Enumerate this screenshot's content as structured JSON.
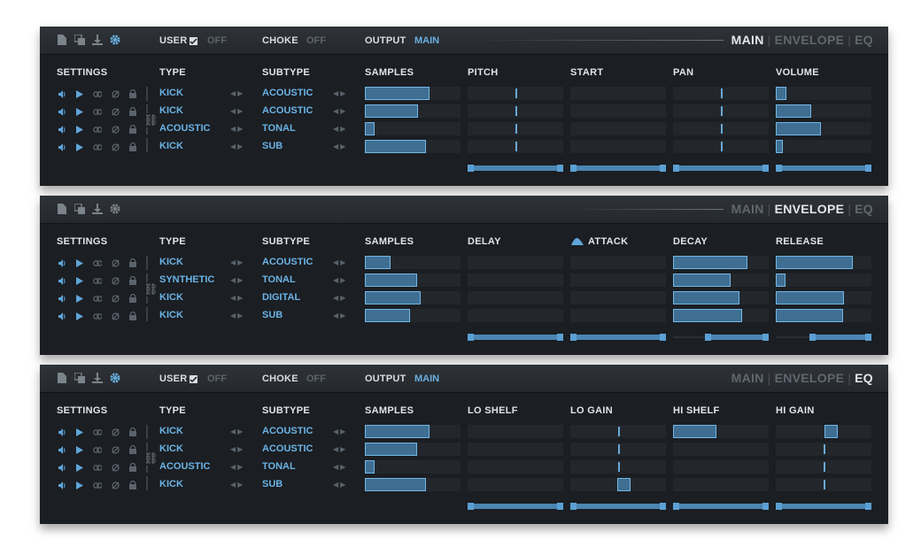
{
  "header": {
    "user_label": "USER",
    "user_value": "OFF",
    "choke_label": "CHOKE",
    "choke_value": "OFF",
    "output_label": "OUTPUT",
    "output_value": "MAIN",
    "tab_main": "MAIN",
    "tab_envelope": "ENVELOPE",
    "tab_eq": "EQ",
    "sep": "|"
  },
  "columns": {
    "settings": "SETTINGS",
    "type": "TYPE",
    "subtype": "SUBTYPE",
    "samples": "SAMPLES"
  },
  "colors": {
    "accent": "#68afe0",
    "panel": "#1b1e22",
    "fill": "#3f6e92",
    "outline": "#72b7e6"
  },
  "panels": [
    {
      "mode": "main",
      "active_tab": "MAIN",
      "param_headers": [
        "PITCH",
        "START",
        "PAN",
        "VOLUME"
      ],
      "rows": [
        {
          "type": "KICK",
          "subtype": "ACOUSTIC"
        },
        {
          "type": "KICK",
          "subtype": "ACOUSTIC"
        },
        {
          "type": "ACOUSTIC",
          "subtype": "TONAL"
        },
        {
          "type": "KICK",
          "subtype": "SUB"
        }
      ],
      "samples": [
        0.68,
        0.56,
        0.1,
        0.64
      ],
      "pitch": [
        0.5,
        0.5,
        0.5,
        0.5
      ],
      "start": [
        0,
        0,
        0,
        0
      ],
      "pan": [
        0.5,
        0.5,
        0.5,
        0.5
      ],
      "volume": [
        0.11,
        0.37,
        0.47,
        0.06
      ]
    },
    {
      "mode": "envelope",
      "active_tab": "ENVELOPE",
      "param_headers": [
        "DELAY",
        "ATTACK",
        "DECAY",
        "RELEASE"
      ],
      "rows": [
        {
          "type": "KICK",
          "subtype": "ACOUSTIC"
        },
        {
          "type": "SYNTHETIC",
          "subtype": "TONAL"
        },
        {
          "type": "KICK",
          "subtype": "DIGITAL"
        },
        {
          "type": "KICK",
          "subtype": "SUB"
        }
      ],
      "samples": [
        0.27,
        0.55,
        0.58,
        0.47
      ],
      "delay": [
        0,
        0,
        0,
        0
      ],
      "attack": [
        0,
        0,
        0,
        0
      ],
      "decay": [
        0.78,
        0.6,
        0.69,
        0.72
      ],
      "release": [
        0.81,
        0.1,
        0.71,
        0.7
      ]
    },
    {
      "mode": "eq",
      "active_tab": "EQ",
      "param_headers": [
        "LO SHELF",
        "LO GAIN",
        "HI SHELF",
        "HI GAIN"
      ],
      "rows": [
        {
          "type": "KICK",
          "subtype": "ACOUSTIC"
        },
        {
          "type": "KICK",
          "subtype": "ACOUSTIC"
        },
        {
          "type": "ACOUSTIC",
          "subtype": "TONAL"
        },
        {
          "type": "KICK",
          "subtype": "SUB"
        }
      ],
      "samples": [
        0.68,
        0.55,
        0.1,
        0.64
      ],
      "lo_shelf": [
        0,
        0,
        0,
        0
      ],
      "lo_gain": [
        0.5,
        0.5,
        0.5,
        0.56
      ],
      "hi_shelf": [
        0.45,
        0,
        0,
        0
      ],
      "hi_gain": [
        0.57,
        0.5,
        0.5,
        0.5
      ]
    }
  ],
  "icons": [
    "document-icon",
    "copy-icon",
    "download-icon",
    "gear-icon",
    "speaker-icon",
    "play-icon",
    "link-icon",
    "mute-icon",
    "lock-icon"
  ]
}
